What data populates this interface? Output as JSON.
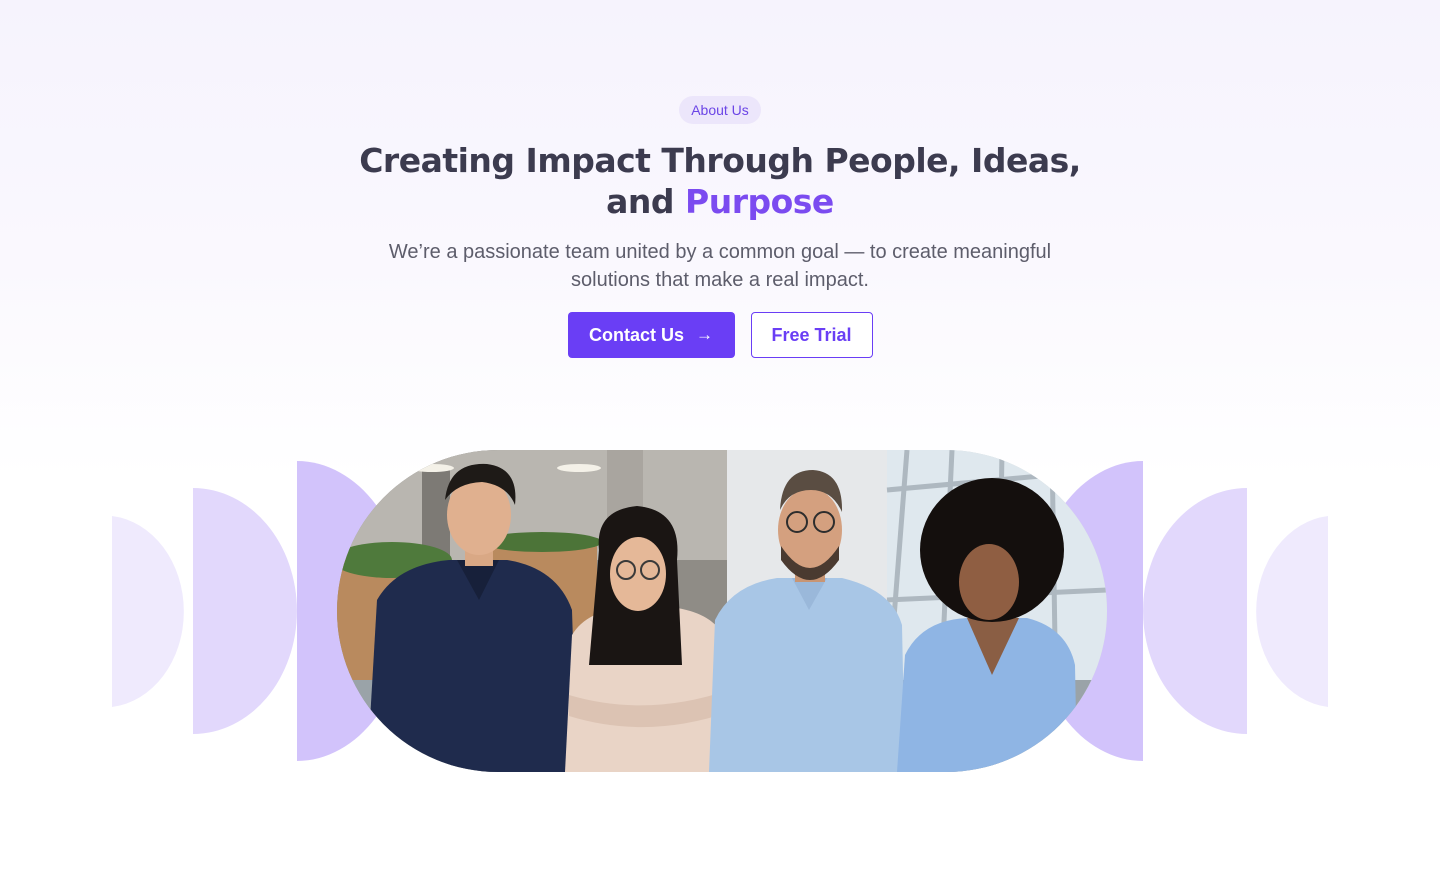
{
  "hero": {
    "badge_label": "About Us",
    "title_main": "Creating Impact Through People, Ideas, and",
    "title_accent": "Purpose",
    "subtitle": "We’re a passionate team united by a common goal — to create meaningful solutions that make a real impact.",
    "contact_button_label": "Contact Us",
    "contact_button_icon": "arrow-right-icon",
    "trial_button_label": "Free Trial"
  },
  "team_photo": {
    "subject": "team-of-four-professionals"
  },
  "colors": {
    "accent": "#6a3ef5",
    "accent_text": "#7b4bf0",
    "heading": "#3c3b4f",
    "body_text": "#5d5d6b",
    "badge_bg": "#ece6fb",
    "decor_light": "#efeafd",
    "decor_mid": "#e2d8fc",
    "decor_strong": "#d2c3fb"
  }
}
